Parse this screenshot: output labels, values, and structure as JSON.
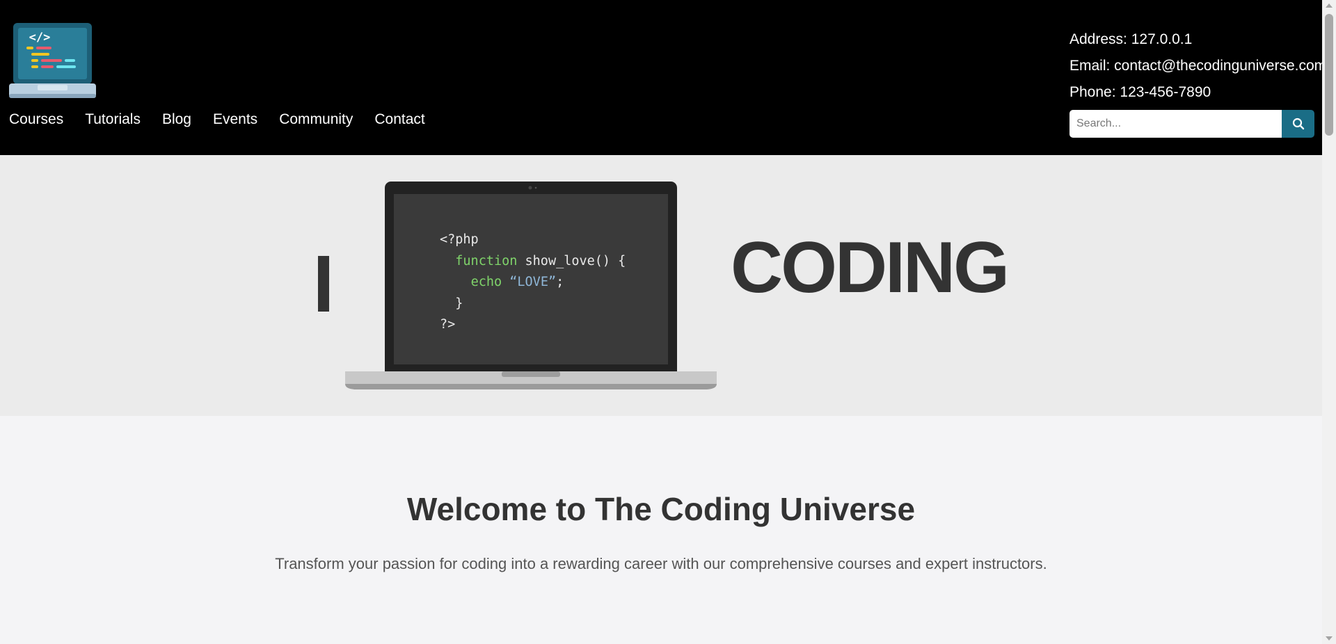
{
  "header": {
    "nav": [
      {
        "label": "Courses"
      },
      {
        "label": "Tutorials"
      },
      {
        "label": "Blog"
      },
      {
        "label": "Events"
      },
      {
        "label": "Community"
      },
      {
        "label": "Contact"
      }
    ],
    "contact": {
      "address": "Address: 127.0.0.1",
      "email": "Email: contact@thecodinguniverse.com",
      "phone": "Phone: 123-456-7890"
    },
    "search": {
      "placeholder": "Search...",
      "icon": "search-icon"
    }
  },
  "hero": {
    "letter": "I",
    "word": "CODING",
    "code": {
      "line1": "<?php",
      "line2_kw": "function",
      "line2_rest": " show_love() {",
      "line3_kw": "echo",
      "line3_str": "“LOVE”",
      "line3_end": ";",
      "line4": "}",
      "line5": "?>"
    }
  },
  "welcome": {
    "title": "Welcome to The Coding Universe",
    "text": "Transform your passion for coding into a rewarding career with our comprehensive courses and expert instructors."
  },
  "colors": {
    "header_bg": "#000000",
    "accent": "#1a6d86",
    "hero_bg": "#ebebeb",
    "page_bg": "#f4f4f6"
  }
}
